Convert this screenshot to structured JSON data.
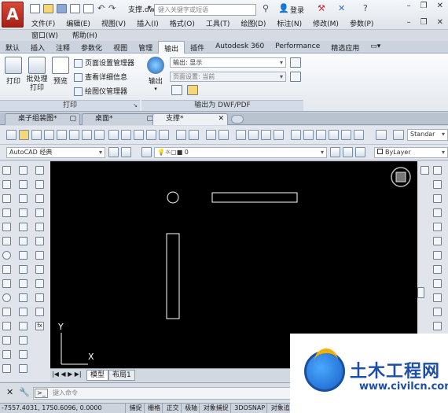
{
  "title_bar": {
    "doc_title": "支撑.dwg",
    "search_placeholder": "键入关键字或短语",
    "login": "登录",
    "logo_letter": "A"
  },
  "menu_bar": {
    "row1": [
      "文件(F)",
      "编辑(E)",
      "视图(V)",
      "插入(I)",
      "格式(O)",
      "工具(T)",
      "绘图(D)",
      "标注(N)",
      "修改(M)",
      "参数(P)"
    ],
    "row2": [
      "窗口(W)",
      "帮助(H)"
    ]
  },
  "ribbon_tabs": [
    "默认",
    "插入",
    "注释",
    "参数化",
    "视图",
    "管理",
    "输出",
    "插件",
    "Autodesk 360",
    "Performance",
    "精选应用"
  ],
  "ribbon_active_tab": "输出",
  "ribbon": {
    "print_panel": {
      "title": "打印",
      "print": "打印",
      "batch_print": "批处理打印",
      "preview": "预览",
      "page_setup_manager": "页面设置管理器",
      "view_details": "查看详细信息",
      "plotter_manager": "绘图仪管理器"
    },
    "export_panel": {
      "title": "输出为 DWF/PDF",
      "export": "输出",
      "export_value": "输出: 显示",
      "page_setup_value": "页面设置: 当前"
    }
  },
  "doc_tabs": [
    {
      "label": "桌子组装图*",
      "active": false
    },
    {
      "label": "桌面*",
      "active": false
    },
    {
      "label": "支撑*",
      "active": true
    }
  ],
  "toolbar2": {
    "workspace": "AutoCAD 经典",
    "layer": "0",
    "linetype": "ByLayer",
    "standard": "Standar"
  },
  "model_tabs": [
    "模型",
    "布局1"
  ],
  "active_model_tab": "模型",
  "ucs": {
    "x_label": "X",
    "y_label": "Y"
  },
  "command": {
    "placeholder": "键入命令"
  },
  "status": {
    "coords": "-7557.4031, 1750.6096, 0.0000",
    "buttons": [
      "捕捉",
      "栅格",
      "正交",
      "极轴",
      "对象捕捉",
      "3DOSNAP",
      "对象追踪"
    ]
  },
  "watermark": {
    "name": "土木工程网",
    "url": "www.civilcn.com"
  },
  "colors": {
    "canvas": "#000000",
    "accent_red": "#c0281c",
    "watermark_blue": "#1d4fa8"
  }
}
